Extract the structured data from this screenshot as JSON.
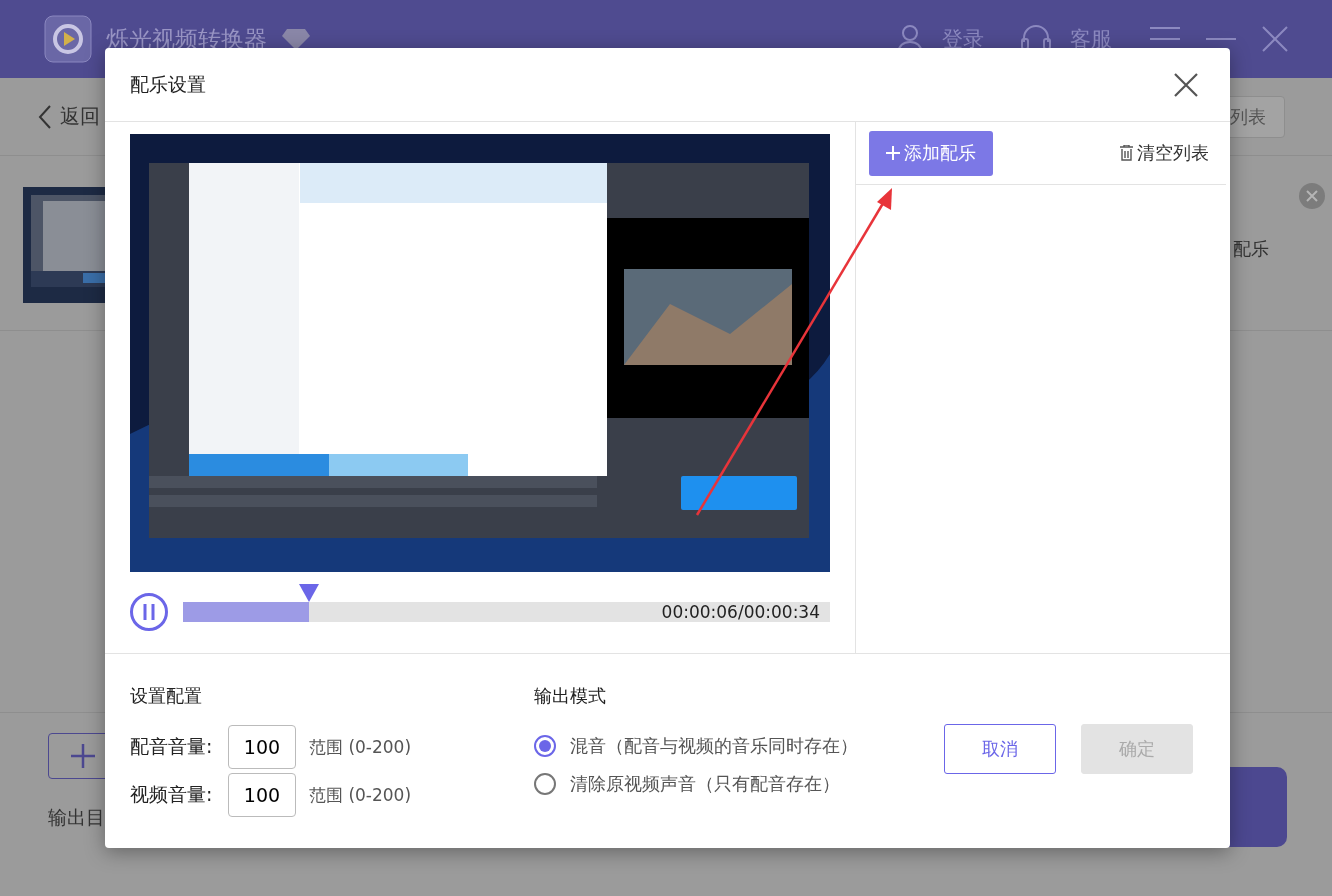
{
  "app": {
    "title": "烁光视频转换器",
    "login": "登录",
    "service": "客服"
  },
  "background": {
    "back": "返回",
    "list_button": "列表",
    "file_text": "配乐",
    "output_label": "输出目"
  },
  "dialog": {
    "title": "配乐设置",
    "player": {
      "level": 0.195,
      "time": "00:00:06/00:00:34"
    },
    "add_button": "添加配乐",
    "clear_button": "清空列表",
    "settings": {
      "heading": "设置配置",
      "fields": [
        {
          "label": "配音音量:",
          "value": "100",
          "hint": "范围 (0-200)"
        },
        {
          "label": "视频音量:",
          "value": "100",
          "hint": "范围 (0-200)"
        }
      ]
    },
    "output_mode": {
      "heading": "输出模式",
      "options": [
        {
          "label": "混音（配音与视频的音乐同时存在）",
          "selected": true
        },
        {
          "label": "清除原视频声音（只有配音存在）",
          "selected": false
        }
      ]
    },
    "buttons": [
      {
        "label": "取消",
        "disabled": false
      },
      {
        "label": "确定",
        "disabled": true
      }
    ]
  }
}
